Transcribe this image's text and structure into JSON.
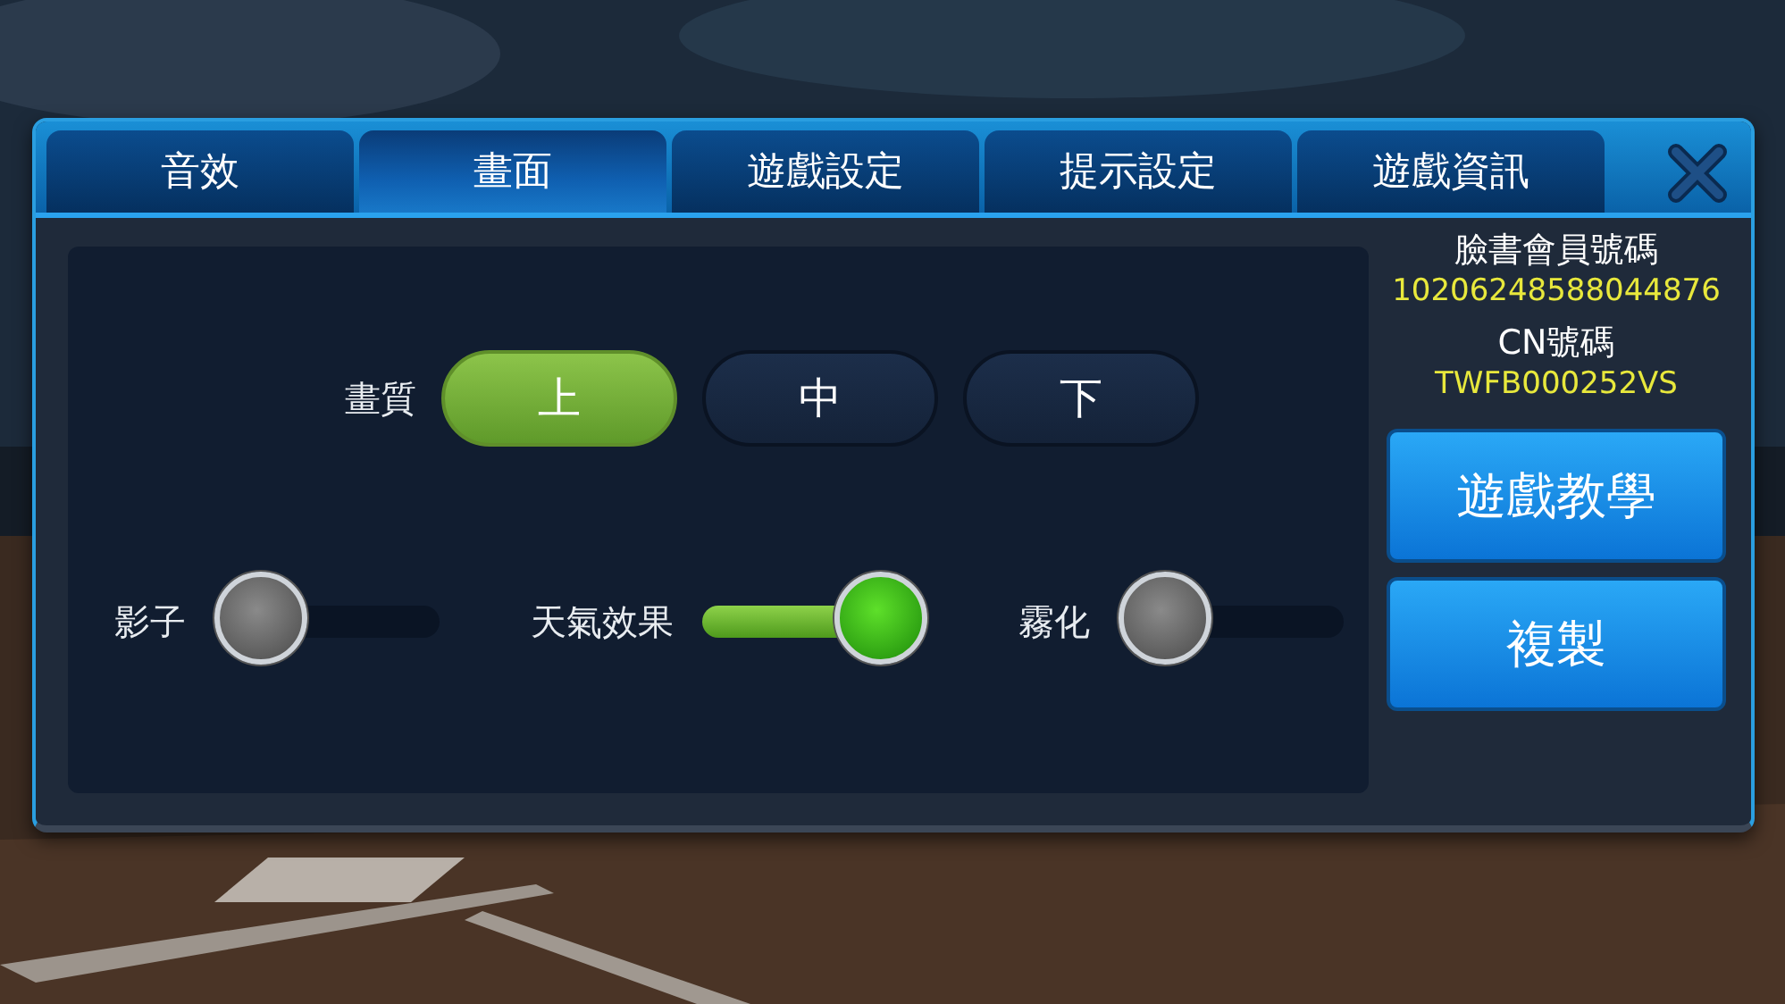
{
  "tabs": [
    {
      "label": "音效",
      "selected": false
    },
    {
      "label": "畫面",
      "selected": true
    },
    {
      "label": "遊戲設定",
      "selected": false
    },
    {
      "label": "提示設定",
      "selected": false
    },
    {
      "label": "遊戲資訊",
      "selected": false
    }
  ],
  "quality": {
    "label": "畫質",
    "options": [
      {
        "label": "上",
        "selected": true
      },
      {
        "label": "中",
        "selected": false
      },
      {
        "label": "下",
        "selected": false
      }
    ]
  },
  "switches": [
    {
      "label": "影子",
      "on": false
    },
    {
      "label": "天氣效果",
      "on": true
    },
    {
      "label": "霧化",
      "on": false
    }
  ],
  "account": {
    "facebook_label": "臉書會員號碼",
    "facebook_id": "10206248588044876",
    "cn_label": "CN號碼",
    "cn_id": "TWFB000252VS"
  },
  "buttons": [
    "遊戲教學",
    "複製"
  ]
}
